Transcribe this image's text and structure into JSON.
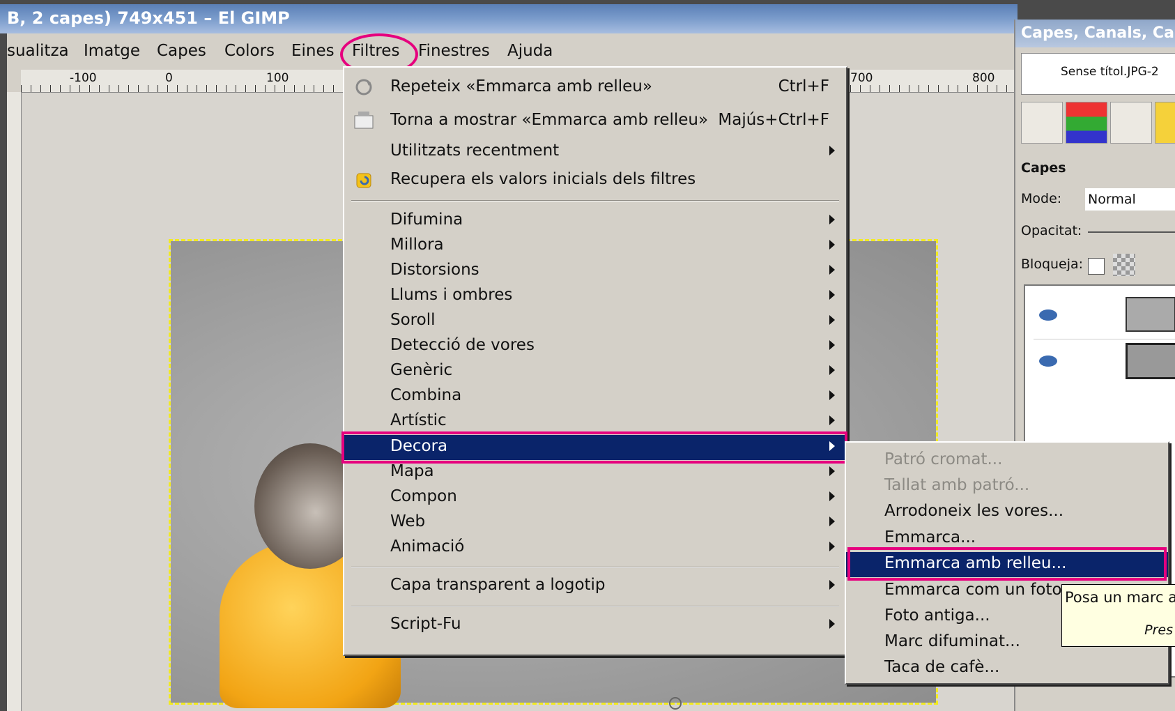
{
  "window": {
    "title": "B, 2 capes) 749x451 – El GIMP"
  },
  "menubar": {
    "items": [
      "sualitza",
      "Imatge",
      "Capes",
      "Colors",
      "Eines",
      "Filtres",
      "Finestres",
      "Ajuda"
    ]
  },
  "ruler": {
    "labels": [
      "-100",
      "0",
      "100",
      "700",
      "800"
    ]
  },
  "filters_menu": {
    "repeat": {
      "label": "Repeteix «Emmarca amb relleu»",
      "shortcut": "Ctrl+F"
    },
    "reshow": {
      "label": "Torna a mostrar «Emmarca amb relleu»",
      "shortcut": "Majús+Ctrl+F"
    },
    "recent": "Utilitzats recentment",
    "reset": "Recupera els valors inicials dels filtres",
    "groups": [
      "Difumina",
      "Millora",
      "Distorsions",
      "Llums i ombres",
      "Soroll",
      "Detecció de vores",
      "Genèric",
      "Combina",
      "Artístic",
      "Decora",
      "Mapa",
      "Compon",
      "Web",
      "Animació"
    ],
    "active": "Decora",
    "logo": "Capa transparent a logotip",
    "scriptfu": "Script-Fu"
  },
  "decora_submenu": {
    "items": [
      {
        "label": "Patró cromat...",
        "disabled": true
      },
      {
        "label": "Tallat amb patró...",
        "disabled": true
      },
      {
        "label": "Arrodoneix les vores...",
        "disabled": false
      },
      {
        "label": "Emmarca...",
        "disabled": false
      },
      {
        "label": "Emmarca amb relleu...",
        "disabled": false,
        "active": true
      },
      {
        "label": "Emmarca com un fotogr",
        "disabled": false
      },
      {
        "label": "Foto antiga...",
        "disabled": false
      },
      {
        "label": "Marc difuminat...",
        "disabled": false
      },
      {
        "label": "Taca de cafè...",
        "disabled": false
      }
    ]
  },
  "tooltip": {
    "text": "Posa un marc a",
    "hint": "Pres"
  },
  "dock": {
    "title": "Capes, Canals, Cam",
    "image_tab": "Sense títol.JPG-2",
    "section": "Capes",
    "mode_label": "Mode:",
    "mode_value": "Normal",
    "opacity_label": "Opacitat:",
    "lock_label": "Bloqueja:"
  },
  "colors": {
    "highlight": "#e6007e",
    "selection": "#0a246a",
    "menu_bg": "#d4d0c8",
    "marching_ants": "#f2ea20"
  }
}
